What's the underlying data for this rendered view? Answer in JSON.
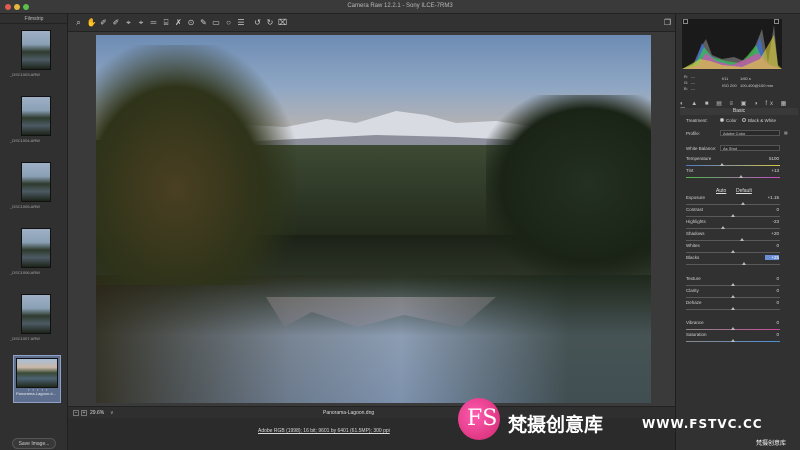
{
  "window": {
    "title": "Camera Raw 12.2.1  -  Sony ILCE-7RM3"
  },
  "filmstrip": {
    "header": "Filmstrip",
    "items": [
      {
        "label": "_DSC1003.ARW"
      },
      {
        "label": "_DSC1004.ARW"
      },
      {
        "label": "_DSC1005.ARW"
      },
      {
        "label": "_DSC1006.ARW"
      },
      {
        "label": "_DSC1007.ARW"
      },
      {
        "label": "Panorama-Lagoon.d..."
      }
    ],
    "selected_dots": "• • • • •",
    "save_label": "Save Image..."
  },
  "toolbar": {
    "tools": [
      "zoom-icon",
      "hand-icon",
      "white-balance-icon",
      "color-sampler-icon",
      "target-adjust-icon",
      "crop-icon",
      "straighten-icon",
      "transform-icon",
      "spot-removal-icon",
      "red-eye-icon",
      "adjustment-brush-icon",
      "graduated-filter-icon",
      "radial-filter-icon",
      "open-preferences-icon",
      "rotate-ccw-icon",
      "rotate-cw-icon",
      "trash-icon"
    ],
    "tool_glyphs": [
      "⌕",
      "✋",
      "✐",
      "✐",
      "⌖",
      "⌖",
      "═",
      "⌸",
      "✗",
      "⊙",
      "✎",
      "▭",
      "○",
      "☰",
      "↺",
      "↻",
      "⌧"
    ],
    "fullscreen_glyph": "❐"
  },
  "canvas": {
    "filename": "Panorama-Lagoon.dng"
  },
  "status": {
    "zoom_minus": "−",
    "zoom_plus": "+",
    "zoom": "29.6%",
    "zoom_dropdown": "∨",
    "workflow_link": "Adobe RGB (1998); 16 bit; 9601 by 6401 (61.5MP); 300 ppi"
  },
  "histogram": {
    "readout_r_label": "R:",
    "readout_g_label": "G:",
    "readout_b_label": "B:",
    "readout_r": "---",
    "readout_g": "---",
    "readout_b": "---",
    "aperture": "f/11",
    "shutter": "1/60 s",
    "iso": "ISO 200",
    "lens": "100-400@100 mm"
  },
  "panel": {
    "tabs_glyphs": "◐ ▲ ■ ▤ ≡ ▣ ◑ fx ▦ ☰ ●",
    "section": "Basic",
    "treatment_label": "Treatment:",
    "color_label": "Color",
    "bw_label": "Black & White",
    "profile_label": "Profile:",
    "profile_value": "Adobe Color",
    "wb_label": "White Balance:",
    "wb_value": "As Shot",
    "auto_label": "Auto",
    "default_label": "Default",
    "sliders": [
      {
        "label": "Temperature",
        "value": "5100",
        "level": 0.38,
        "kind": "temp"
      },
      {
        "label": "Tint",
        "value": "+13",
        "level": 0.58,
        "kind": "tint"
      },
      {
        "label": "Exposure",
        "value": "+1.15",
        "level": 0.61,
        "kind": "plain"
      },
      {
        "label": "Contrast",
        "value": "0",
        "level": 0.5,
        "kind": "plain"
      },
      {
        "label": "Highlights",
        "value": "-23",
        "level": 0.39,
        "kind": "plain"
      },
      {
        "label": "Shadows",
        "value": "+20",
        "level": 0.6,
        "kind": "plain"
      },
      {
        "label": "Whites",
        "value": "0",
        "level": 0.5,
        "kind": "plain"
      },
      {
        "label": "Blacks",
        "value": "+25",
        "level": 0.62,
        "kind": "plain",
        "selected": true
      },
      {
        "label": "Texture",
        "value": "0",
        "level": 0.5,
        "kind": "plain"
      },
      {
        "label": "Clarity",
        "value": "0",
        "level": 0.5,
        "kind": "plain"
      },
      {
        "label": "Dehaze",
        "value": "0",
        "level": 0.5,
        "kind": "plain"
      },
      {
        "label": "Vibrance",
        "value": "0",
        "level": 0.5,
        "kind": "vib"
      },
      {
        "label": "Saturation",
        "value": "0",
        "level": 0.5,
        "kind": "sat"
      }
    ]
  },
  "watermark": {
    "logo": "FS",
    "brand_cn": "梵摄创意库",
    "site": "WWW.FSTVC.CC",
    "small": "梵摄创意库"
  },
  "colors": {
    "accent_selected": "#6c8ed8",
    "watermark": "#e0348a"
  }
}
